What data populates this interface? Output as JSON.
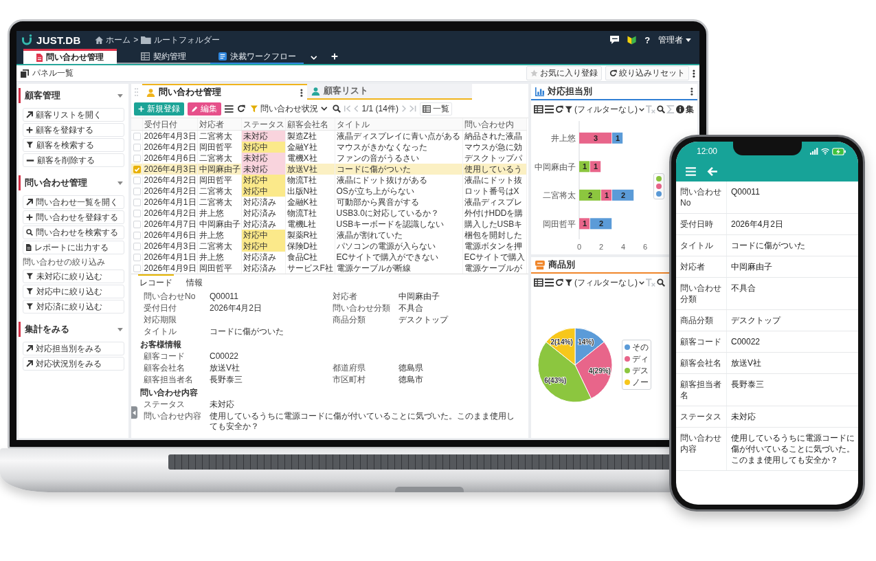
{
  "laptop": {
    "header": {
      "logo": "JUST.DB",
      "breadcrumb": [
        {
          "label": "ホーム",
          "kind": "home"
        },
        {
          "label": "ルートフォルダー",
          "kind": "folder"
        }
      ],
      "separator": ">",
      "help": "?",
      "user": "管理者"
    },
    "tabs": [
      {
        "label": "問い合わせ管理",
        "kind": "document",
        "color": "#e0344c",
        "selected": true
      },
      {
        "label": "契約管理",
        "kind": "table",
        "color": "#9aa1a9",
        "selected": false
      },
      {
        "label": "決裁ワークフロー",
        "kind": "window",
        "color": "#2e86de",
        "selected": false
      }
    ],
    "panel_bar": {
      "title": "パネル一覧",
      "actions": [
        {
          "label": "お気に入り登録",
          "kind": "star"
        },
        {
          "label": "絞り込みリセット",
          "kind": "reset"
        }
      ]
    },
    "sidebar": {
      "sections": [
        {
          "title": "顧客管理",
          "expanded": true,
          "items": [
            {
              "label": "顧客リストを開く",
              "kind": "open"
            },
            {
              "label": "顧客を登録する",
              "kind": "add"
            },
            {
              "label": "顧客を検索する",
              "kind": "filter"
            },
            {
              "label": "顧客を削除する",
              "kind": "remove"
            }
          ]
        },
        {
          "title": "問い合わせ管理",
          "expanded": true,
          "items": [
            {
              "label": "問い合わせ一覧を開く",
              "kind": "open"
            },
            {
              "label": "問い合わせを登録する",
              "kind": "add"
            },
            {
              "label": "問い合わせを検索する",
              "kind": "search"
            },
            {
              "label": "レポートに出力する",
              "kind": "report"
            },
            {
              "label": "問い合わせの絞り込み",
              "kind": "label"
            },
            {
              "label": "未対応に絞り込む",
              "kind": "filter"
            },
            {
              "label": "対応中に絞り込む",
              "kind": "filter"
            },
            {
              "label": "対応済に絞り込む",
              "kind": "filter"
            }
          ]
        },
        {
          "title": "集計をみる",
          "expanded": true,
          "items": [
            {
              "label": "対応担当別をみる",
              "kind": "open"
            },
            {
              "label": "対応状況別をみる",
              "kind": "open"
            }
          ]
        }
      ]
    },
    "main_panel": {
      "tabs": [
        {
          "label": "問い合わせ管理",
          "color": "#f0b41c",
          "selected": true
        },
        {
          "label": "顧客リスト",
          "color": "#27a69b",
          "selected": false
        }
      ],
      "toolbar": {
        "new_button": "新規登録",
        "edit_button": "編集",
        "filter": "問い合わせ状況",
        "pager": "1/1 (14件)",
        "view": "一覧"
      },
      "table": {
        "columns": [
          "受付日付",
          "対応者",
          "ステータス",
          "顧客会社名",
          "タイトル",
          "問い合わせ内"
        ],
        "rows": [
          {
            "selected": false,
            "cells": [
              "2026年4月3日",
              "二宮将太",
              {
                "text": "未対応",
                "color": "#f9d4dd"
              },
              "製造Z社",
              "液晶ディスプレイに青い点がある",
              "納品された液晶"
            ]
          },
          {
            "selected": false,
            "cells": [
              "2026年4月2日",
              "岡田哲平",
              {
                "text": "対応中",
                "color": "#fbe98a"
              },
              "金融Y社",
              "マウスがきかなくなった",
              "マウスが急に効"
            ]
          },
          {
            "selected": false,
            "cells": [
              "2026年4月6日",
              "二宮将太",
              {
                "text": "未対応",
                "color": "#f9d4dd"
              },
              "電機X社",
              "ファンの音がうるさい",
              "デスクトップパ"
            ]
          },
          {
            "selected": true,
            "cells": [
              "2026年4月3日",
              "中岡麻由子",
              {
                "text": "未対応",
                "color": "#f9d4dd"
              },
              "放送V社",
              "コードに傷がついた",
              "使用しているう"
            ]
          },
          {
            "selected": false,
            "cells": [
              "2026年4月2日",
              "岡田哲平",
              {
                "text": "対応中",
                "color": "#fbe98a"
              },
              "物流T社",
              "液晶にドット抜けがある",
              "液晶にドット抜"
            ]
          },
          {
            "selected": false,
            "cells": [
              "2026年4月2日",
              "二宮将太",
              {
                "text": "対応中",
                "color": "#fbe98a"
              },
              "出版N社",
              "OSが立ち上がらない",
              "ロット番号はX"
            ]
          },
          {
            "selected": false,
            "cells": [
              "2026年4月1日",
              "二宮将太",
              "対応済み",
              "金融K社",
              "可動部から異音がする",
              "液晶ディスプレ"
            ]
          },
          {
            "selected": false,
            "cells": [
              "2026年4月2日",
              "井上悠",
              "対応済み",
              "物流T社",
              "USB3.0に対応しているか？",
              "外付けHDDを購"
            ]
          },
          {
            "selected": false,
            "cells": [
              "2026年4月7日",
              "中岡麻由子",
              "対応済み",
              "電機L社",
              "USBキーボードを認識しない",
              "購入したUSBキ"
            ]
          },
          {
            "selected": false,
            "cells": [
              "2026年4月6日",
              "井上悠",
              {
                "text": "対応中",
                "color": "#fbe98a"
              },
              "製薬R社",
              "液晶が割れていた",
              "梱包を開封した"
            ]
          },
          {
            "selected": false,
            "cells": [
              "2026年4月3日",
              "二宮将太",
              {
                "text": "対応中",
                "color": "#fbe98a"
              },
              "保険D社",
              "パソコンの電源が入らない",
              "電源ボタンを押"
            ]
          },
          {
            "selected": false,
            "cells": [
              "2026年4月1日",
              "井上悠",
              "対応済み",
              "食品C社",
              "ECサイトで購入ができない",
              "ECサイトで購入"
            ]
          },
          {
            "selected": false,
            "cells": [
              "2026年4月9日",
              "岡田哲平",
              "対応済み",
              "サービスF社",
              "電源ケーブルが断線",
              "電源ケーブルが"
            ]
          }
        ]
      },
      "record": {
        "tabs": [
          {
            "label": "レコード",
            "selected": true
          },
          {
            "label": "情報",
            "selected": false
          }
        ],
        "sections": [
          {
            "rows": [
              [
                {
                  "label": "問い合わせNo",
                  "value": "Q00011"
                },
                {
                  "label": "対応者",
                  "value": "中岡麻由子"
                }
              ],
              [
                {
                  "label": "受付日付",
                  "value": "2026年4月2日"
                },
                {
                  "label": "問い合わせ分類",
                  "value": "不具合"
                }
              ],
              [
                {
                  "label": "対応期限"
                },
                {
                  "label": "商品分類",
                  "value": "デスクトップ"
                }
              ],
              [
                {
                  "label": "タイトル",
                  "value": "コードに傷がついた"
                }
              ]
            ]
          },
          {
            "title": "お客様情報",
            "rows": [
              [
                {
                  "label": "顧客コード",
                  "value": "C00022"
                }
              ],
              [
                {
                  "label": "顧客会社名",
                  "value": "放送V社"
                },
                {
                  "label": "都道府県",
                  "value": "徳島県"
                }
              ],
              [
                {
                  "label": "顧客担当者名",
                  "value": "長野泰三"
                },
                {
                  "label": "市区町村",
                  "value": "徳島市"
                }
              ]
            ]
          },
          {
            "title": "問い合わせ内容",
            "rows": [
              [
                {
                  "label": "ステータス",
                  "value": "未対応"
                }
              ],
              [
                {
                  "label": "問い合わせ内容",
                  "value": "使用しているうちに電源コードに傷が付いていることに気づいた。このまま使用しても安全か？"
                }
              ]
            ]
          }
        ]
      }
    },
    "charts": [
      {
        "title": "対応担当別",
        "color": "#2f7fd4",
        "has_menu": true,
        "tools": [
          {
            "kind": "table",
            "disabled": false
          },
          {
            "kind": "list",
            "disabled": false
          },
          {
            "kind": "refresh",
            "disabled": false
          },
          {
            "kind": "filter",
            "label": "(フィルターなし)",
            "disabled": false
          },
          {
            "kind": "text_format",
            "disabled": true
          },
          {
            "kind": "search",
            "disabled": false
          },
          {
            "kind": "sum",
            "disabled": true
          },
          {
            "kind": "info",
            "disabled": false
          },
          {
            "kind": "text",
            "label": "集",
            "disabled": false
          }
        ],
        "chart_data": {
          "type": "bar",
          "orientation": "horizontal",
          "stacked": true,
          "categories": [
            "井上悠",
            "中岡麻由子",
            "二宮将太",
            "岡田哲平"
          ],
          "series": [
            {
              "color": "#8cc63f",
              "values": [
                0,
                1,
                2,
                0
              ],
              "value_labels": [
                null,
                "1",
                "2",
                null
              ]
            },
            {
              "color": "#e8658a",
              "values": [
                3,
                1,
                1,
                1
              ],
              "value_labels": [
                "3",
                "1",
                "1",
                "1"
              ]
            },
            {
              "color": "#5b9bd8",
              "values": [
                1,
                0,
                2,
                2
              ],
              "value_labels": [
                "1",
                null,
                "2",
                "2"
              ]
            }
          ],
          "xlim": [
            0,
            6
          ],
          "xticks": [
            0,
            2,
            4,
            6
          ]
        }
      },
      {
        "title": "商品別",
        "color": "#f0862a",
        "tools": [
          {
            "kind": "table",
            "disabled": false
          },
          {
            "kind": "list",
            "disabled": false
          },
          {
            "kind": "refresh",
            "disabled": false
          },
          {
            "kind": "filter",
            "label": "(フィルターなし)",
            "disabled": false
          },
          {
            "kind": "text_format",
            "disabled": true
          },
          {
            "kind": "search",
            "disabled": false
          }
        ],
        "chart_data": {
          "type": "pie",
          "categories": [
            "その",
            "ディ",
            "デス",
            "ノー"
          ],
          "values": [
            2,
            4,
            6,
            2
          ],
          "colors": [
            "#5b9bd8",
            "#e8658a",
            "#8cc63f",
            "#f7c71b"
          ],
          "value_labels": [
            null,
            "4(29%)",
            "6(43%)",
            "2(14%)"
          ],
          "annotations": [
            {
              "text": "14%)"
            }
          ]
        }
      }
    ]
  },
  "phone": {
    "time": "12:00",
    "rows": [
      {
        "label": "問い合わせNo",
        "value": "Q00011"
      },
      {
        "label": "受付日時",
        "value": "2026年4月2日"
      },
      {
        "label": "タイトル",
        "value": "コードに傷がついた"
      },
      {
        "label": "対応者",
        "value": "中岡麻由子"
      },
      {
        "label": "問い合わせ分類",
        "value": "不具合"
      },
      {
        "label": "商品分類",
        "value": "デスクトップ"
      },
      {
        "label": "顧客コード",
        "value": "C00022"
      },
      {
        "label": "顧客会社名",
        "value": "放送V社"
      },
      {
        "label": "顧客担当者名",
        "value": "長野泰三"
      },
      {
        "label": "ステータス",
        "value": "未対応"
      },
      {
        "label": "問い合わせ内容",
        "value": "使用しているうちに電源コードに傷が付いていることに気づいた。このまま使用しても安全か？"
      }
    ]
  }
}
